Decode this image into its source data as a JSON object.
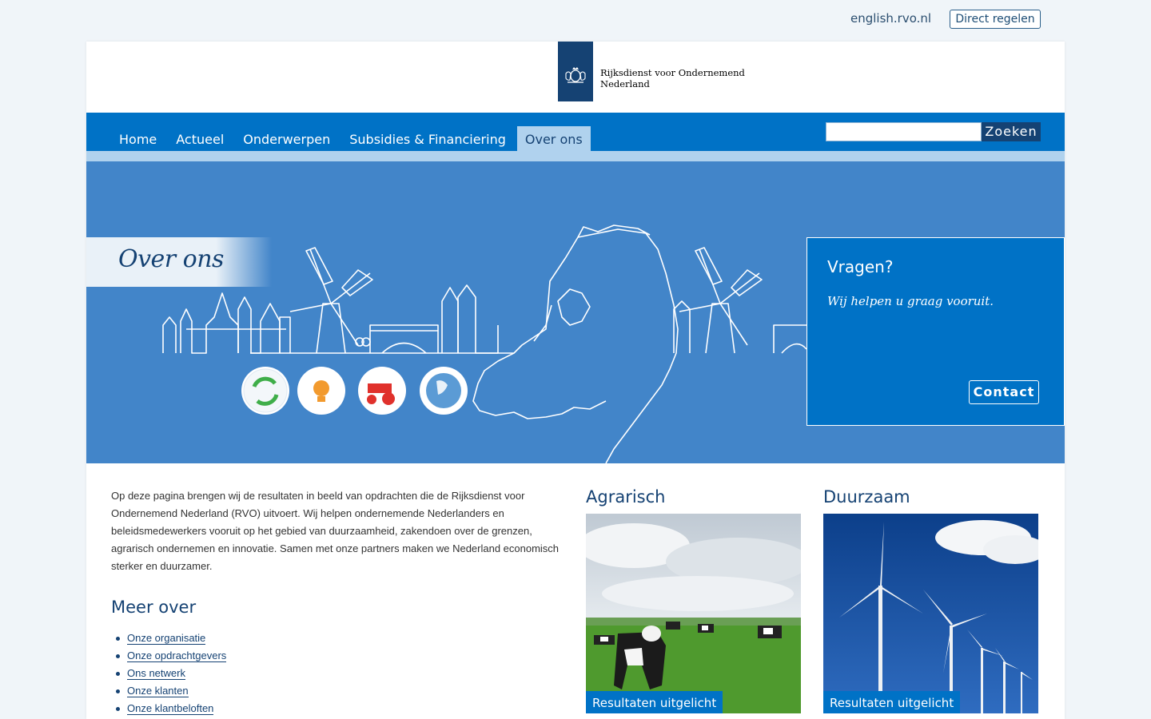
{
  "top": {
    "english_link": "english.rvo.nl",
    "direct_button": "Direct regelen"
  },
  "logo": {
    "line1": "Rijksdienst voor Ondernemend",
    "line2": "Nederland"
  },
  "nav": {
    "items": [
      "Home",
      "Actueel",
      "Onderwerpen",
      "Subsidies & Financiering",
      "Over ons"
    ],
    "active_index": 4,
    "search_placeholder": "",
    "search_button": "Zoeken"
  },
  "hero": {
    "title": "Over ons",
    "icons": [
      "recycle-icon",
      "lightbulb-icon",
      "tractor-icon",
      "globe-icon"
    ]
  },
  "questions": {
    "title": "Vragen?",
    "subtitle": "Wij helpen u graag vooruit.",
    "button": "Contact"
  },
  "intro": "Op deze pagina brengen wij de resultaten in beeld van opdrachten die de Rijksdienst voor Ondernemend Nederland (RVO) uitvoert. Wij helpen ondernemende Nederlanders en beleidsmedewerkers vooruit op het gebied van duurzaamheid, zakendoen over de grenzen, agrarisch ondernemen en innovatie. Samen met onze partners maken we Nederland economisch sterker en duurzamer.",
  "meer_over": {
    "title": "Meer over",
    "links": [
      "Onze organisatie",
      "Onze opdrachtgevers",
      "Ons netwerk",
      "Onze klanten",
      "Onze klantbeloften"
    ]
  },
  "cards": [
    {
      "title": "Agrarisch",
      "label": "Resultaten uitgelicht"
    },
    {
      "title": "Duurzaam",
      "label": "Resultaten uitgelicht"
    }
  ],
  "colors": {
    "brand_dark": "#154273",
    "brand_blue": "#0072c6",
    "hero_blue": "#4285c9",
    "light_blue": "#b0d2ee"
  }
}
